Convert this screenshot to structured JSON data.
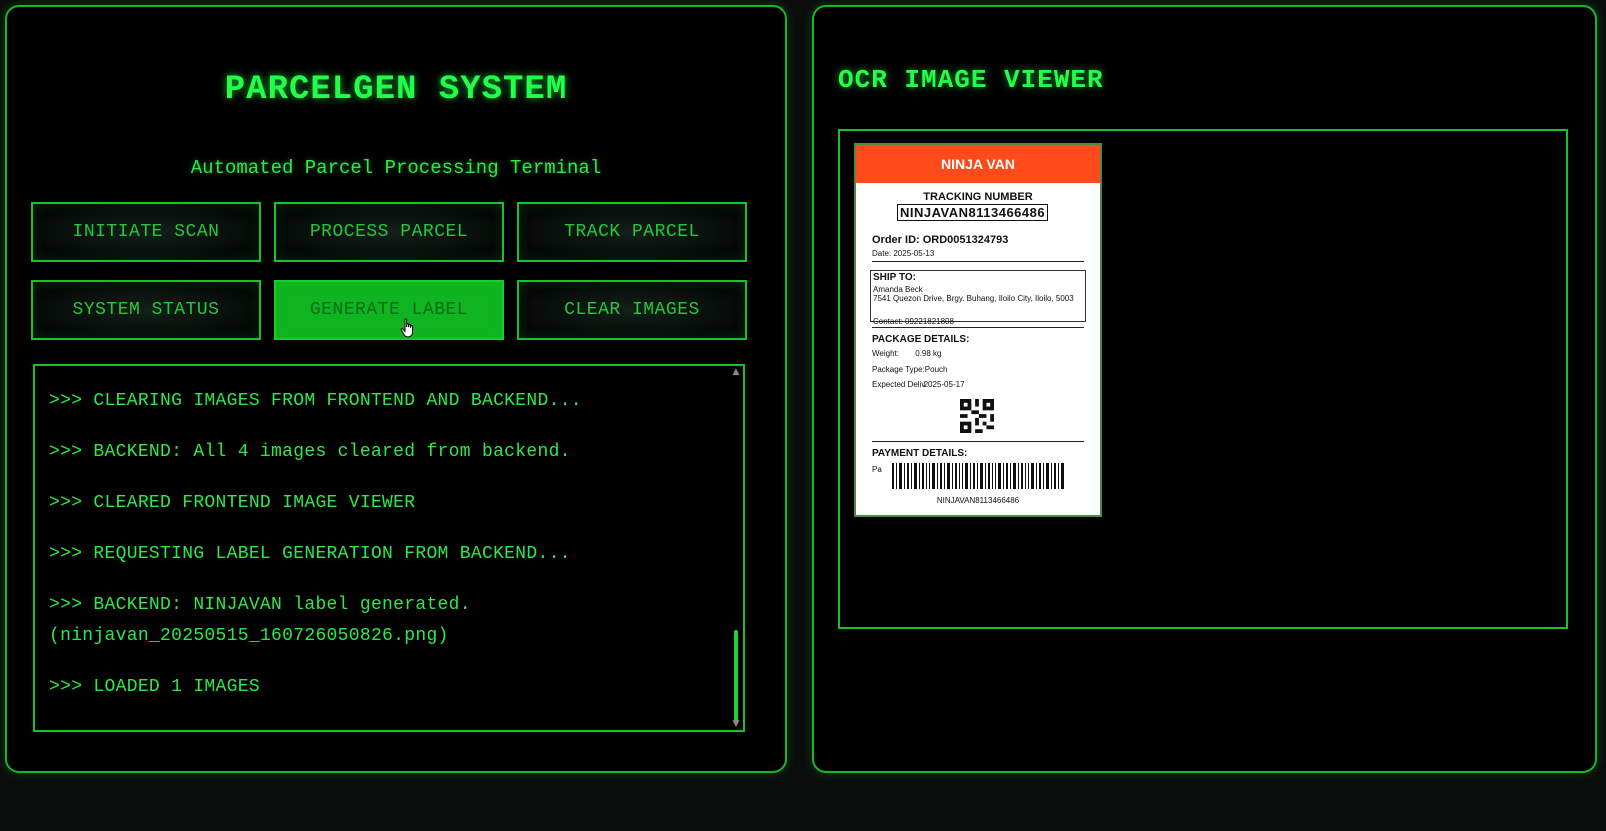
{
  "left": {
    "title": "PARCELGEN SYSTEM",
    "subtitle": "Automated Parcel Processing Terminal",
    "buttons": [
      {
        "label": "INITIATE SCAN"
      },
      {
        "label": "PROCESS PARCEL"
      },
      {
        "label": "TRACK PARCEL"
      },
      {
        "label": "SYSTEM STATUS"
      },
      {
        "label": "GENERATE LABEL"
      },
      {
        "label": "CLEAR IMAGES"
      }
    ],
    "active_button": "GENERATE LABEL",
    "console": [
      ">>> CLEARING IMAGES FROM FRONTEND AND BACKEND...",
      ">>> BACKEND: All 4 images cleared from backend.",
      ">>> CLEARED FRONTEND IMAGE VIEWER",
      ">>> REQUESTING LABEL GENERATION FROM BACKEND...",
      ">>> BACKEND: NINJAVAN label generated. (ninjavan_20250515_160726050826.png)",
      ">>> LOADED 1 IMAGES"
    ]
  },
  "right": {
    "title": "OCR IMAGE VIEWER",
    "label": {
      "carrier": "NINJA VAN",
      "tracking_caption": "TRACKING NUMBER",
      "tracking_number": "NINJAVAN8113466486",
      "order_id": "Order ID: ORD0051324793",
      "date": "Date: 2025-05-13",
      "ship_to_title": "SHIP TO:",
      "ship_name": "Amanda Beck",
      "ship_address": "7541 Quezon Drive, Brgy. Buhang, Iloilo City, Iloilo, 5003",
      "ship_contact": "Contact: 09221821808",
      "package_title": "PACKAGE DETAILS:",
      "weight_label": "Weight:",
      "weight_value": "0.98 kg",
      "package_type": "Package Type:Pouch",
      "expected_label": "Expected Deliv",
      "expected_value": "2025-05-17",
      "payment_title": "PAYMENT DETAILS:",
      "payment_prefix": "Pa",
      "barcode_text": "NINJAVAN8113466486"
    }
  },
  "colors": {
    "accent": "#16b82a",
    "text_green": "#2de84a",
    "active_button_bg": "#0eb520",
    "carrier_header": "#ff4a1a"
  }
}
